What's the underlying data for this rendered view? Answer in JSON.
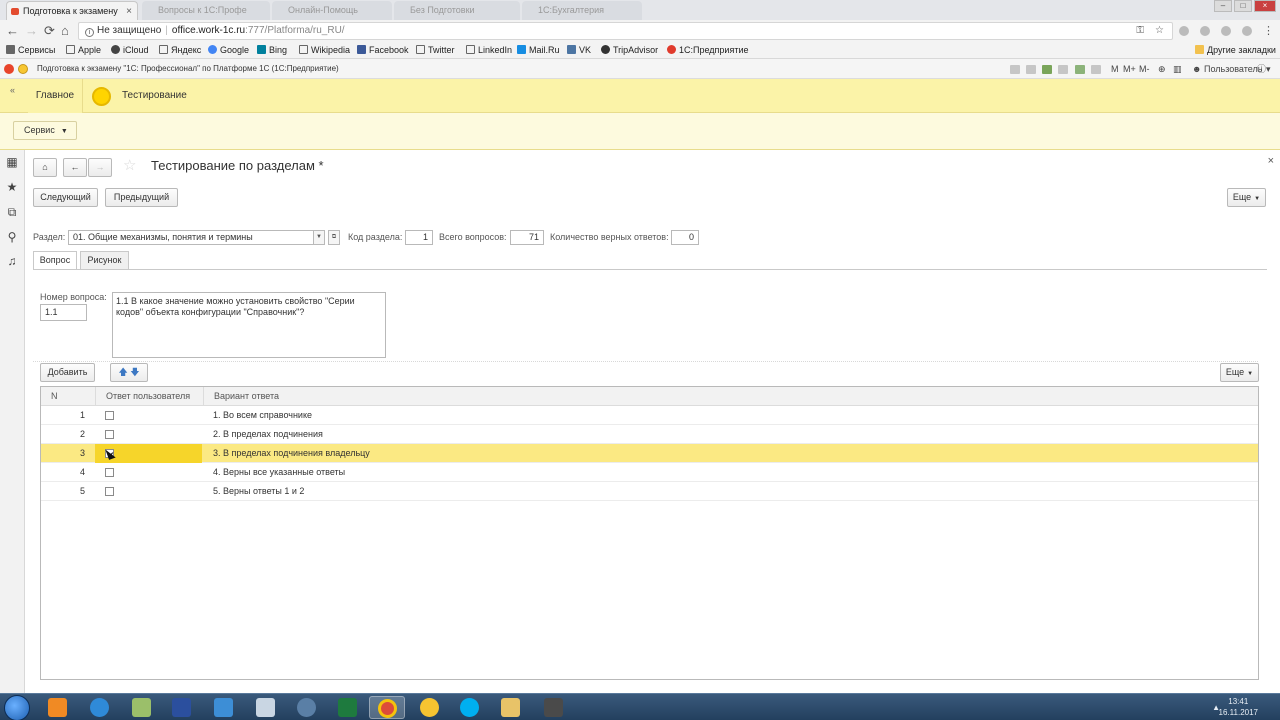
{
  "browser": {
    "active_tab": "Подготовка к экзамену",
    "background_tabs": [
      "Вопросы к 1С:Профе",
      "Онлайн-Помощь",
      "Без Подготовки",
      "1С:Бухгалтерия"
    ],
    "nav": {
      "back": "←",
      "forward": "→",
      "reload": "⟳",
      "home": "⌂"
    },
    "security": "Не защищено",
    "url_host": "office.work-1c.ru",
    "url_path": ":777/Platforma/ru_RU/",
    "bookmarks": [
      "Сервисы",
      "Apple",
      "iCloud",
      "Яндекс",
      "Google",
      "Bing",
      "Wikipedia",
      "Facebook",
      "Twitter",
      "LinkedIn",
      "Mail.Ru",
      "VK",
      "TripAdvisor",
      "1С:Предприятие"
    ],
    "other_bookmarks": "Другие закладки"
  },
  "app": {
    "title": "Подготовка к экзамену \"1С: Профессионал\" по Платформе 1С  (1С:Предприятие)",
    "toolbar_labels": [
      "M",
      "M+",
      "M-"
    ],
    "user": "Пользователь"
  },
  "sections": {
    "collapse": "«",
    "main": "Главное",
    "testing": "Тестирование"
  },
  "functions": {
    "service": "Сервис"
  },
  "form": {
    "title": "Тестирование по разделам *",
    "next_button": "Следующий",
    "prev_button": "Предыдущий",
    "more_button": "Еще",
    "section_label": "Раздел:",
    "section_value": "01. Общие механизмы, понятия и термины",
    "code_label": "Код раздела:",
    "code_value": "1",
    "total_label": "Всего вопросов:",
    "total_value": "71",
    "correct_label": "Количество верных ответов:",
    "correct_value": "0",
    "tabs": [
      "Вопрос",
      "Рисунок"
    ],
    "question_no_label": "Номер вопроса:",
    "question_no": "1.1",
    "question_text": "1.1 В какое значение можно установить свойство \"Серии кодов\" объекта конфигурации \"Справочник\"?",
    "add_button": "Добавить",
    "table_more": "Еще",
    "table": {
      "columns": [
        "N",
        "Ответ пользователя",
        "Вариант ответа"
      ],
      "rows": [
        {
          "n": "1",
          "checked": false,
          "answer": "1. Во всем справочнике"
        },
        {
          "n": "2",
          "checked": false,
          "answer": "2. В пределах подчинения"
        },
        {
          "n": "3",
          "checked": true,
          "answer": "3. В пределах подчинения владельцу"
        },
        {
          "n": "4",
          "checked": false,
          "answer": "4. Верны все указанные ответы"
        },
        {
          "n": "5",
          "checked": false,
          "answer": "5. Верны ответы 1 и 2"
        }
      ]
    }
  },
  "taskbar": {
    "time": "13:41",
    "date": "16.11.2017"
  },
  "colors": {
    "sections_bg": "#fbf3a8",
    "selected_row": "#fbe983",
    "selected_cell": "#f6d52a"
  }
}
